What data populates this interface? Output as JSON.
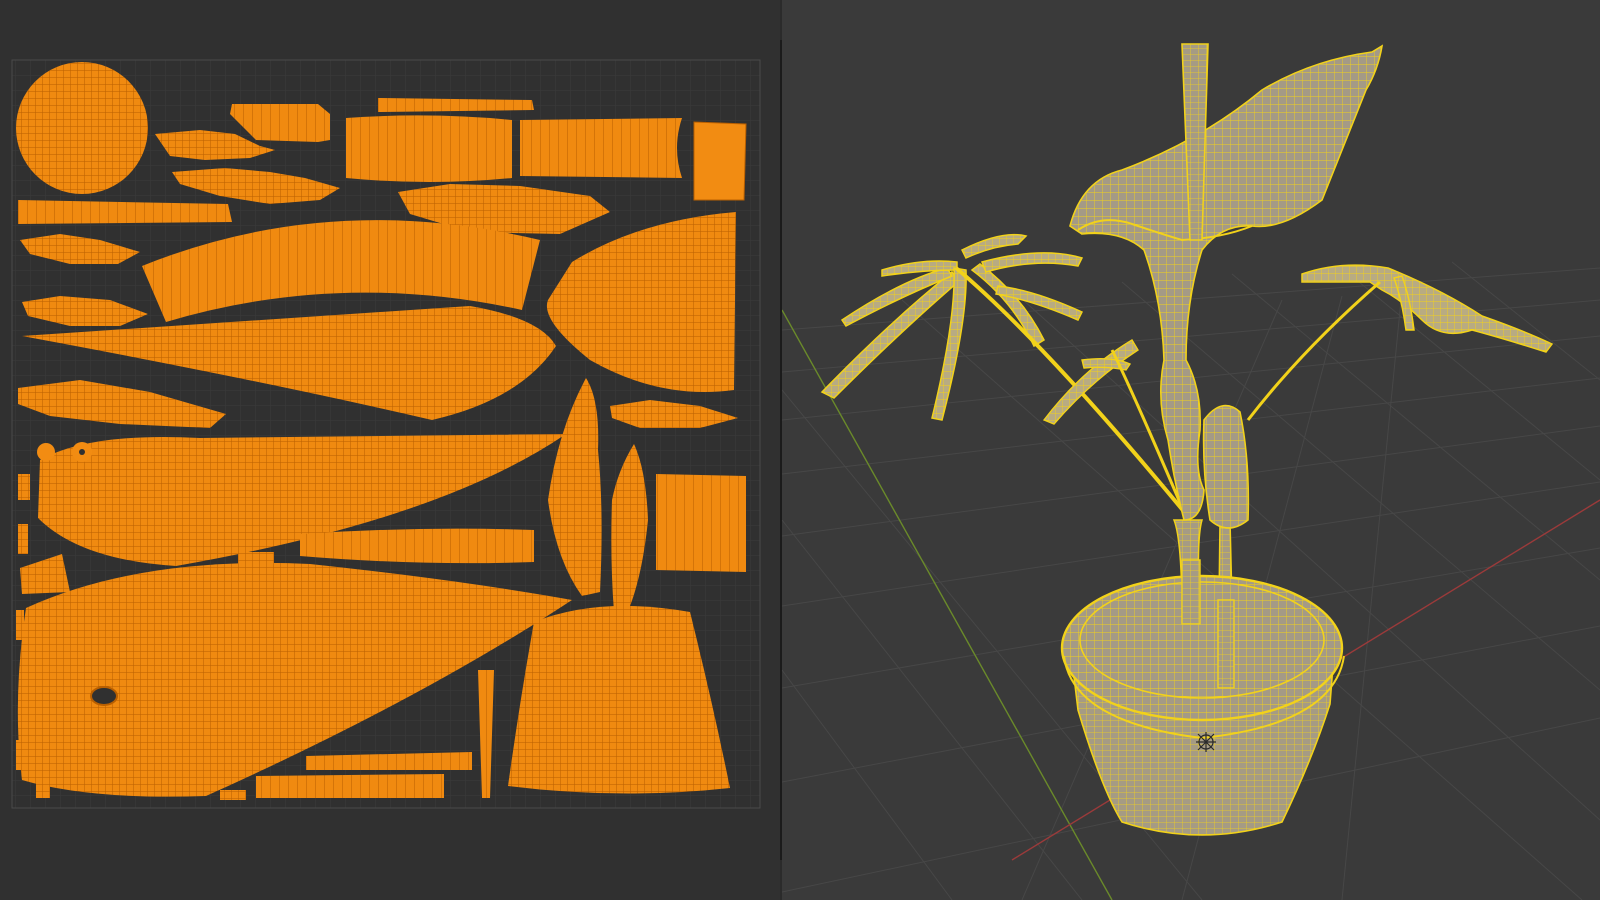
{
  "colors": {
    "background": "#2b2b2b",
    "uv_background": "#303030",
    "uv_grid": "#3d3d3d",
    "uv_island_fill": "#f08a10",
    "uv_island_wire": "#b95f00",
    "viewport_background": "#3a3a3a",
    "viewport_grid": "#474747",
    "axis_x": "#9b3a3a",
    "axis_y": "#6a8a2a",
    "mesh_fill": "#a49a86",
    "mesh_wire": "#f2d21a"
  },
  "icons": {
    "origin": "3d-cursor-icon"
  }
}
